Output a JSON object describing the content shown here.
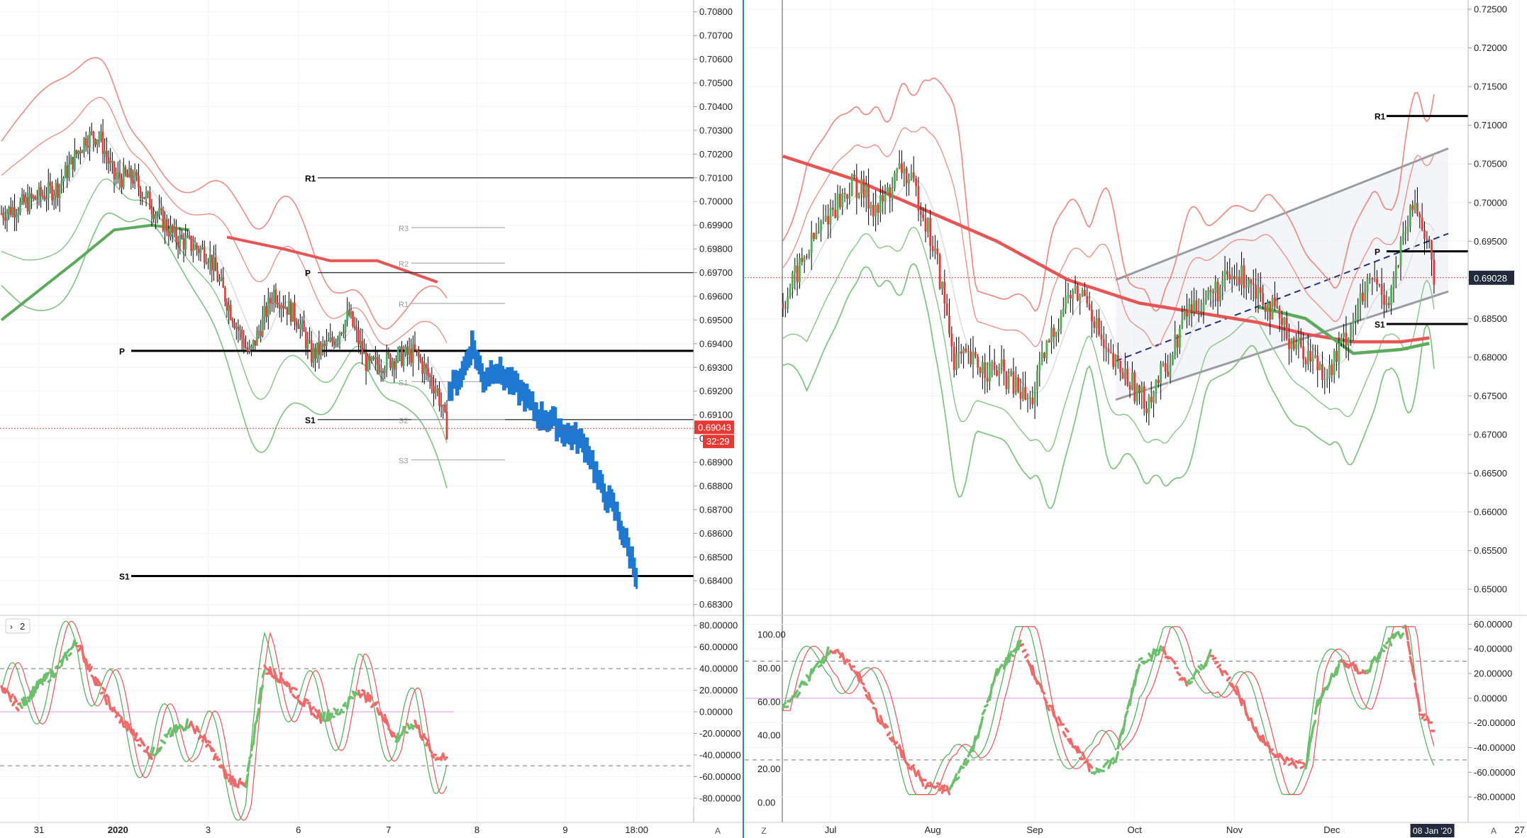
{
  "panels": {
    "left": {
      "price_axis_ticks": [
        "0.70800",
        "0.70700",
        "0.70600",
        "0.70500",
        "0.70400",
        "0.70300",
        "0.70200",
        "0.70100",
        "0.70000",
        "0.69900",
        "0.69800",
        "0.69700",
        "0.69600",
        "0.69500",
        "0.69400",
        "0.69300",
        "0.69200",
        "0.69100",
        "0.69000",
        "0.68900",
        "0.68800",
        "0.68700",
        "0.68600",
        "0.68500",
        "0.68400",
        "0.68300"
      ],
      "price_tick_values": [
        0.708,
        0.707,
        0.706,
        0.705,
        0.704,
        0.703,
        0.702,
        0.701,
        0.7,
        0.699,
        0.698,
        0.697,
        0.696,
        0.695,
        0.694,
        0.693,
        0.692,
        0.691,
        0.69,
        0.689,
        0.688,
        0.687,
        0.686,
        0.685,
        0.684,
        0.683
      ],
      "time_labels": [
        "31",
        "2020",
        "3",
        "6",
        "7",
        "8",
        "9",
        "18:00"
      ],
      "time_bar_index": [
        20,
        62,
        110,
        158,
        206,
        253,
        300,
        338
      ],
      "price_label": "0.69043",
      "countdown_label": "32:29",
      "pivot_labels": [
        "R1",
        "P",
        "S1",
        "R3",
        "R2",
        "R1",
        "S2",
        "S3",
        "S1"
      ],
      "big_pivots": [
        {
          "label": "P",
          "value": 0.6937
        },
        {
          "label": "S1",
          "value": 0.6842
        }
      ],
      "small_pivots": [
        {
          "label": "R1",
          "value": 0.701
        },
        {
          "label": "P",
          "value": 0.697
        },
        {
          "label": "S1",
          "value": 0.6908
        }
      ],
      "faint_pivots": [
        {
          "label": "R3",
          "value": 0.6989
        },
        {
          "label": "R2",
          "value": 0.6974
        },
        {
          "label": "R1",
          "value": 0.6957
        },
        {
          "label": "S2",
          "value": 0.6908
        },
        {
          "label": "S3",
          "value": 0.6891
        },
        {
          "label": "S1",
          "value": 0.6924
        }
      ],
      "osc_axis_ticks": [
        "80.00000",
        "60.00000",
        "40.00000",
        "20.00000",
        "0.00000",
        "-20.00000",
        "-40.00000",
        "-60.00000",
        "-80.00000"
      ],
      "osc_tick_values": [
        80,
        60,
        40,
        20,
        0,
        -20,
        -40,
        -60,
        -80
      ],
      "osc_toggle_label": "2",
      "osc_levels": [
        40,
        -50
      ],
      "axis_button": "A"
    },
    "right": {
      "price_axis_ticks": [
        "0.72500",
        "0.72000",
        "0.71500",
        "0.71000",
        "0.70500",
        "0.70000",
        "0.69500",
        "0.69000",
        "0.68500",
        "0.68000",
        "0.67500",
        "0.67000",
        "0.66500",
        "0.66000",
        "0.65500",
        "0.65000"
      ],
      "price_tick_values": [
        0.725,
        0.72,
        0.715,
        0.71,
        0.705,
        0.7,
        0.695,
        0.69,
        0.685,
        0.68,
        0.675,
        0.67,
        0.665,
        0.66,
        0.655,
        0.65
      ],
      "time_labels": [
        "Jul",
        "Aug",
        "Sep",
        "Oct",
        "Nov",
        "Dec",
        "27"
      ],
      "time_bar_index": [
        20,
        63,
        106,
        148,
        190,
        231,
        310
      ],
      "crosshair_date": "08 Jan '20",
      "price_label": "0.69028",
      "pivot_labels": [
        "R1",
        "P",
        "S1"
      ],
      "pivots": [
        {
          "label": "R1",
          "value": 0.7112
        },
        {
          "label": "P",
          "value": 0.6937
        },
        {
          "label": "S1",
          "value": 0.6843
        }
      ],
      "osc_axis_ticks": [
        "60.00000",
        "40.00000",
        "20.00000",
        "0.00000",
        "-20.00000",
        "-40.00000",
        "-60.00000",
        "-80.00000"
      ],
      "osc_tick_values": [
        60,
        40,
        20,
        0,
        -20,
        -40,
        -60,
        -80
      ],
      "osc_left_ticks": [
        "100.00",
        "80.00",
        "60.00",
        "40.00",
        "20.00",
        "0.00"
      ],
      "osc_left_values": [
        100,
        80,
        60,
        40,
        20,
        0
      ],
      "osc_levels": [
        30,
        -50
      ],
      "z_button": "Z",
      "axis_button": "A"
    }
  },
  "chart_data": [
    {
      "type": "line",
      "description_ref": "left candlestick chart",
      "ylim": [
        0.6826,
        0.7085
      ],
      "candles_close_anchors": [
        [
          0,
          0.6995
        ],
        [
          15,
          0.7
        ],
        [
          30,
          0.7006
        ],
        [
          45,
          0.7027
        ],
        [
          52,
          0.7028
        ],
        [
          60,
          0.701
        ],
        [
          70,
          0.701
        ],
        [
          80,
          0.6998
        ],
        [
          92,
          0.6985
        ],
        [
          110,
          0.6978
        ],
        [
          125,
          0.6948
        ],
        [
          132,
          0.6935
        ],
        [
          145,
          0.6962
        ],
        [
          158,
          0.695
        ],
        [
          165,
          0.6935
        ],
        [
          175,
          0.694
        ],
        [
          185,
          0.6952
        ],
        [
          195,
          0.693
        ],
        [
          210,
          0.6934
        ],
        [
          220,
          0.6936
        ],
        [
          232,
          0.692
        ],
        [
          237,
          0.6904
        ]
      ],
      "projection_anchors": [
        [
          238,
          0.692
        ],
        [
          245,
          0.6928
        ],
        [
          250,
          0.694
        ],
        [
          256,
          0.6925
        ],
        [
          262,
          0.693
        ],
        [
          270,
          0.6924
        ],
        [
          278,
          0.6918
        ],
        [
          285,
          0.691
        ],
        [
          292,
          0.6908
        ],
        [
          300,
          0.6902
        ],
        [
          306,
          0.69
        ],
        [
          312,
          0.6895
        ],
        [
          318,
          0.688
        ],
        [
          326,
          0.687
        ],
        [
          332,
          0.6856
        ],
        [
          338,
          0.6842
        ]
      ],
      "ma_red": [
        [
          120,
          0.6985
        ],
        [
          150,
          0.698
        ],
        [
          175,
          0.6975
        ],
        [
          200,
          0.6975
        ],
        [
          232,
          0.6966
        ]
      ],
      "ma_green": [
        [
          0,
          0.695
        ],
        [
          40,
          0.6975
        ],
        [
          60,
          0.6988
        ],
        [
          80,
          0.699
        ],
        [
          100,
          0.6988
        ]
      ]
    },
    {
      "type": "line",
      "description_ref": "right daily candlestick chart",
      "ylim": [
        0.6468,
        0.7262
      ],
      "close_anchors": [
        [
          0,
          0.687
        ],
        [
          10,
          0.6935
        ],
        [
          20,
          0.699
        ],
        [
          30,
          0.7025
        ],
        [
          40,
          0.699
        ],
        [
          50,
          0.7045
        ],
        [
          58,
          0.7
        ],
        [
          65,
          0.692
        ],
        [
          72,
          0.68
        ],
        [
          82,
          0.679
        ],
        [
          92,
          0.678
        ],
        [
          104,
          0.674
        ],
        [
          112,
          0.682
        ],
        [
          120,
          0.688
        ],
        [
          128,
          0.688
        ],
        [
          136,
          0.68
        ],
        [
          146,
          0.677
        ],
        [
          152,
          0.674
        ],
        [
          162,
          0.679
        ],
        [
          170,
          0.686
        ],
        [
          180,
          0.688
        ],
        [
          188,
          0.69
        ],
        [
          196,
          0.6905
        ],
        [
          204,
          0.687
        ],
        [
          212,
          0.683
        ],
        [
          222,
          0.68
        ],
        [
          230,
          0.678
        ],
        [
          240,
          0.685
        ],
        [
          248,
          0.69
        ],
        [
          255,
          0.6875
        ],
        [
          262,
          0.696
        ],
        [
          266,
          0.7
        ],
        [
          270,
          0.6965
        ],
        [
          274,
          0.6903
        ]
      ],
      "ma_red": [
        [
          0,
          0.706
        ],
        [
          30,
          0.703
        ],
        [
          60,
          0.699
        ],
        [
          90,
          0.695
        ],
        [
          120,
          0.69
        ],
        [
          150,
          0.687
        ],
        [
          180,
          0.6855
        ],
        [
          200,
          0.6845
        ],
        [
          220,
          0.683
        ],
        [
          240,
          0.682
        ],
        [
          260,
          0.682
        ],
        [
          272,
          0.6825
        ]
      ],
      "ma_green": [
        [
          200,
          0.6865
        ],
        [
          220,
          0.685
        ],
        [
          240,
          0.6805
        ],
        [
          260,
          0.681
        ],
        [
          272,
          0.6818
        ]
      ],
      "channel_upper": [
        [
          140,
          0.69
        ],
        [
          280,
          0.707
        ]
      ],
      "channel_lower": [
        [
          140,
          0.6745
        ],
        [
          280,
          0.6885
        ]
      ],
      "dashed_trend": [
        [
          140,
          0.6795
        ],
        [
          280,
          0.696
        ]
      ]
    },
    {
      "type": "line",
      "description_ref": "left oscillator",
      "ylim": [
        -88,
        88
      ],
      "oscillator_anchors": [
        [
          0,
          20
        ],
        [
          10,
          5
        ],
        [
          20,
          25
        ],
        [
          30,
          40
        ],
        [
          40,
          65
        ],
        [
          50,
          30
        ],
        [
          60,
          0
        ],
        [
          70,
          -20
        ],
        [
          80,
          -40
        ],
        [
          90,
          -20
        ],
        [
          100,
          -10
        ],
        [
          110,
          -30
        ],
        [
          120,
          -60
        ],
        [
          130,
          -70
        ],
        [
          140,
          40
        ],
        [
          150,
          30
        ],
        [
          160,
          10
        ],
        [
          170,
          -5
        ],
        [
          180,
          0
        ],
        [
          190,
          20
        ],
        [
          200,
          5
        ],
        [
          210,
          -25
        ],
        [
          220,
          -10
        ],
        [
          230,
          -40
        ],
        [
          237,
          -45
        ]
      ]
    },
    {
      "type": "line",
      "description_ref": "right oscillator",
      "ylim": [
        -88,
        66
      ],
      "oscillator_anchors": [
        [
          0,
          -10
        ],
        [
          10,
          15
        ],
        [
          20,
          40
        ],
        [
          30,
          25
        ],
        [
          40,
          -15
        ],
        [
          50,
          -45
        ],
        [
          60,
          -70
        ],
        [
          70,
          -75
        ],
        [
          80,
          -40
        ],
        [
          90,
          20
        ],
        [
          100,
          45
        ],
        [
          110,
          0
        ],
        [
          120,
          -30
        ],
        [
          130,
          -60
        ],
        [
          140,
          -50
        ],
        [
          150,
          30
        ],
        [
          160,
          40
        ],
        [
          170,
          10
        ],
        [
          180,
          35
        ],
        [
          190,
          10
        ],
        [
          200,
          -30
        ],
        [
          210,
          -50
        ],
        [
          220,
          -55
        ],
        [
          225,
          -5
        ],
        [
          235,
          30
        ],
        [
          245,
          20
        ],
        [
          255,
          45
        ],
        [
          262,
          55
        ],
        [
          268,
          -10
        ],
        [
          274,
          -25
        ]
      ]
    }
  ]
}
